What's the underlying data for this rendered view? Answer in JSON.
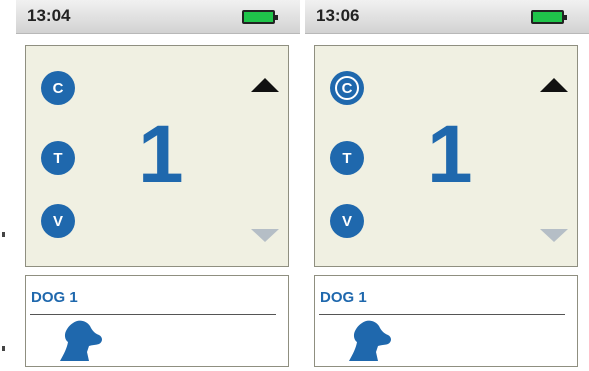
{
  "colors": {
    "accent": "#1f68ad",
    "screen_bg": "#f0f0e2",
    "battery": "#1fc44a"
  },
  "panels": [
    {
      "time": "13:04",
      "battery_icon": "battery-full-icon",
      "modes": [
        {
          "label": "C",
          "active": false
        },
        {
          "label": "T",
          "active": false
        },
        {
          "label": "V",
          "active": false
        }
      ],
      "level": "1",
      "dog_label": "DOG 1",
      "dog_icon": "dog-head-icon"
    },
    {
      "time": "13:06",
      "battery_icon": "battery-full-icon",
      "modes": [
        {
          "label": "C",
          "active": true
        },
        {
          "label": "T",
          "active": false
        },
        {
          "label": "V",
          "active": false
        }
      ],
      "level": "1",
      "dog_label": "DOG 1",
      "dog_icon": "dog-head-icon"
    }
  ]
}
